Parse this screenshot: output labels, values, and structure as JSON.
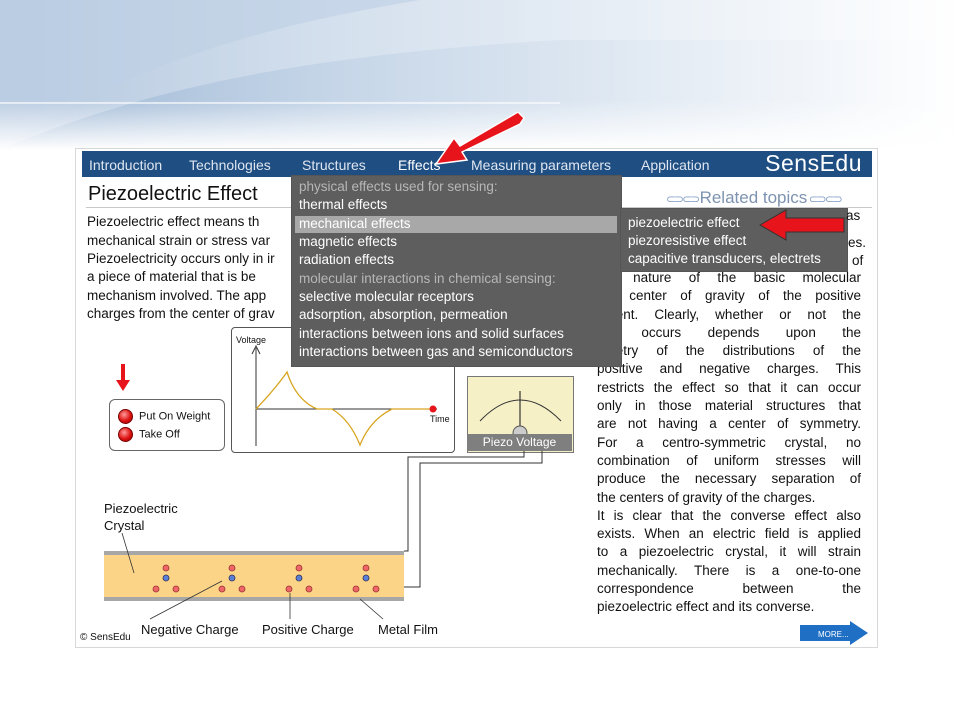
{
  "nav": {
    "items": [
      "Introduction",
      "Technologies",
      "Structures",
      "Effects",
      "Measuring parameters",
      "Application"
    ],
    "brand": "SensEdu"
  },
  "page": {
    "title": "Piezoelectric Effect",
    "related_topics": "Related topics"
  },
  "left_text": [
    "Piezoelectric effect means th",
    "mechanical strain or stress var",
    "Piezoelectricity occurs only in ir",
    "a piece of material that is be",
    "mechanism involved. The app",
    "charges from the center of grav"
  ],
  "right_text_top": [
    "the nature of the basic molecular",
    "the center of gravity of the positive",
    "oment. Clearly, whether or not the",
    "ect occurs depends upon the",
    "nmetry of the distributions of the",
    "positive and negative charges. This",
    "restricts the effect so that it can occur",
    "only in those material structures that",
    "are not having a center of symmetry.",
    "For a centro-symmetric crystal, no",
    "combination of uniform stresses will",
    "produce the necessary separation of"
  ],
  "right_text_bottom": [
    "the centers of gravity of the charges.",
    "It is clear that the converse effect also",
    "exists. When an electric field is applied",
    "to a piezoelectric crystal, it will strain",
    "mechanically. There is a one-to-one",
    "correspondence between the",
    "piezoelectric effect and its converse."
  ],
  "dropdown": {
    "items": [
      {
        "label": "physical effects used for sensing:",
        "kind": "heading"
      },
      {
        "label": "thermal effects",
        "kind": "item"
      },
      {
        "label": "mechanical effects",
        "kind": "selected"
      },
      {
        "label": "magnetic effects",
        "kind": "item"
      },
      {
        "label": "radiation effects",
        "kind": "item"
      },
      {
        "label": "molecular interactions in chemical sensing:",
        "kind": "heading"
      },
      {
        "label": "selective molecular receptors",
        "kind": "item"
      },
      {
        "label": "adsorption, absorption, permeation",
        "kind": "item"
      },
      {
        "label": "interactions between ions and solid surfaces",
        "kind": "item"
      },
      {
        "label": "interactions between gas and semiconductors",
        "kind": "item"
      }
    ]
  },
  "submenu": {
    "items": [
      "piezoelectric effect",
      "piezoresistive effect",
      "capacitive transducers, electrets"
    ],
    "tail_text": [
      "as",
      "es.",
      "of"
    ]
  },
  "diagram": {
    "buttons": [
      "Put On Weight",
      "Take Off"
    ],
    "graph_ylabel": "Voltage",
    "graph_xlabel": "Time",
    "meter_label": "Piezo Voltage",
    "crystal_label_1": "Piezoelectric",
    "crystal_label_2": "Crystal",
    "negative_charge": "Negative Charge",
    "positive_charge": "Positive Charge",
    "metal_film": "Metal Film"
  },
  "footer": {
    "more_label": "MORE...",
    "copyright": "© SensEdu"
  },
  "colors": {
    "nav_bg": "#1f4e82",
    "menu_bg": "#5e5e5e",
    "crystal": "#fbd488",
    "arrow": "#e8141b"
  }
}
